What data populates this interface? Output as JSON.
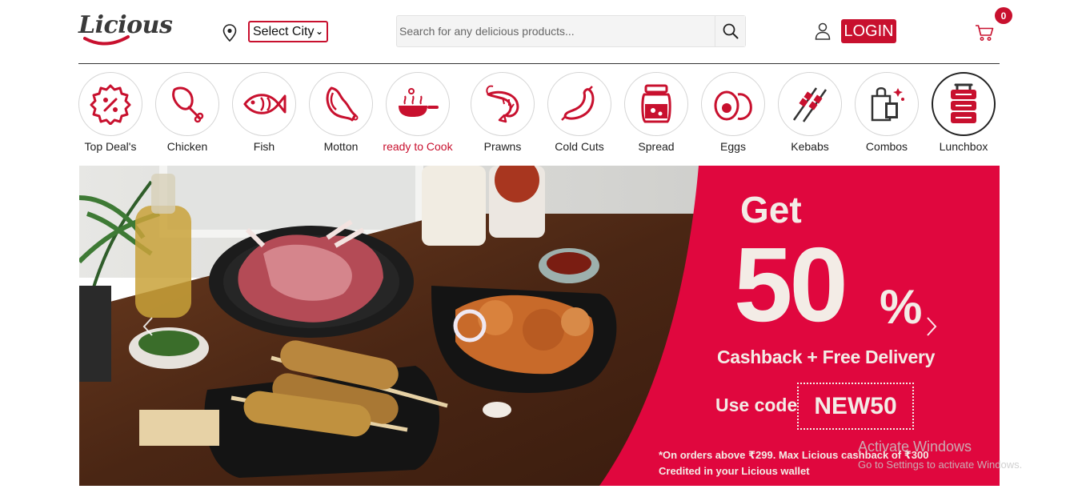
{
  "brand": {
    "logo_text": "Licious",
    "accent_color": "#c8102e"
  },
  "header": {
    "city_select": {
      "value": "Select City"
    },
    "search": {
      "placeholder": "Search for any delicious products..."
    },
    "login_label": "LOGIN",
    "cart_count": "0",
    "icons": [
      "location-pin-icon",
      "search-icon",
      "user-icon",
      "cart-icon"
    ]
  },
  "categories": [
    {
      "label": "Top Deal's",
      "icon": "discount-badge-icon"
    },
    {
      "label": "Chicken",
      "icon": "chicken-leg-icon"
    },
    {
      "label": "Fish",
      "icon": "fish-icon"
    },
    {
      "label": "Motton",
      "icon": "mutton-icon"
    },
    {
      "label": "ready to Cook",
      "icon": "frying-pan-icon",
      "highlight": true
    },
    {
      "label": "Prawns",
      "icon": "prawn-icon"
    },
    {
      "label": "Cold Cuts",
      "icon": "sausage-icon"
    },
    {
      "label": "Spread",
      "icon": "jar-icon"
    },
    {
      "label": "Eggs",
      "icon": "eggs-icon"
    },
    {
      "label": "Kebabs",
      "icon": "skewer-icon"
    },
    {
      "label": "Combos",
      "icon": "shopping-bag-icon"
    },
    {
      "label": "Lunchbox",
      "icon": "lunchbox-icon",
      "selected": true
    }
  ],
  "banner": {
    "get": "Get",
    "percent": "50",
    "percent_sign": "%",
    "subtitle": "Cashback + Free Delivery",
    "use_code": "Use code",
    "code": "NEW50",
    "fine_print_1": "*On orders above ₹299. Max Licious cashback of ₹300",
    "fine_print_2": "Credited in your Licious wallet",
    "promo_color": "#e0073e"
  },
  "watermark": {
    "line1": "Activate Windows",
    "line2": "Go to Settings to activate Windows."
  }
}
